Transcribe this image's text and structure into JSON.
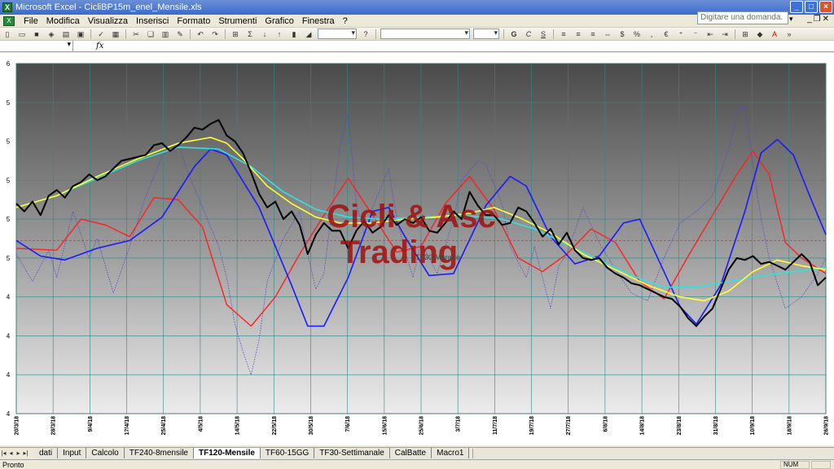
{
  "window": {
    "title": "Microsoft Excel - CicliBP15m_enel_Mensile.xls"
  },
  "menu": [
    "File",
    "Modifica",
    "Visualizza",
    "Inserisci",
    "Formato",
    "Strumenti",
    "Grafico",
    "Finestra",
    "?"
  ],
  "help_placeholder": "Digitare una domanda.",
  "formula": {
    "fx_label": "fx"
  },
  "watermark": {
    "line1": "Cicli & Asc",
    "line2": "Trading"
  },
  "series_label": "TF30-Mensile",
  "sheet_tabs": [
    "dati",
    "Input",
    "Calcolo",
    "TF240-8mensile",
    "TF120-Mensile",
    "TF60-15GG",
    "TF30-Settimanale",
    "CalBatte",
    "Macro1"
  ],
  "active_tab": "TF120-Mensile",
  "status": {
    "text": "Pronto",
    "num": "NUM"
  },
  "colors": {
    "price": "#000000",
    "cycle_red": "#ff2020",
    "cycle_blue": "#1a1aff",
    "ma_yellow": "#ffff33",
    "ma_cyan": "#33e0e0",
    "oscillator": "#4a4ad0",
    "ref_line": "#ff3030",
    "watermark": "#a01010"
  },
  "chart_data": {
    "type": "line",
    "y_ticks": [
      "6",
      "5",
      "5",
      "5",
      "5",
      "5",
      "4",
      "4",
      "4",
      "4"
    ],
    "x_ticks": [
      "20/3/18",
      "28/3/18",
      "9/4/18",
      "17/4/18",
      "25/4/18",
      "4/5/18",
      "14/5/18",
      "22/5/18",
      "30/5/18",
      "7/6/18",
      "15/6/18",
      "25/6/18",
      "3/7/18",
      "11/7/18",
      "19/7/18",
      "27/7/18",
      "6/8/18",
      "14/8/18",
      "23/8/18",
      "31/8/18",
      "10/9/18",
      "18/9/18",
      "26/9/18"
    ],
    "x_domain": [
      0,
      100
    ],
    "y_domain": [
      0,
      9
    ],
    "reference_level": 4.45,
    "series": [
      {
        "key": "price",
        "values": [
          [
            0,
            5.4
          ],
          [
            1,
            5.2
          ],
          [
            2,
            5.45
          ],
          [
            3,
            5.1
          ],
          [
            4,
            5.6
          ],
          [
            5,
            5.75
          ],
          [
            6,
            5.55
          ],
          [
            7,
            5.85
          ],
          [
            8,
            5.95
          ],
          [
            9,
            6.15
          ],
          [
            10,
            6.0
          ],
          [
            11,
            6.1
          ],
          [
            12,
            6.3
          ],
          [
            13,
            6.5
          ],
          [
            14,
            6.55
          ],
          [
            15,
            6.6
          ],
          [
            16,
            6.65
          ],
          [
            17,
            6.9
          ],
          [
            18,
            6.95
          ],
          [
            19,
            6.75
          ],
          [
            20,
            6.9
          ],
          [
            21,
            7.1
          ],
          [
            22,
            7.35
          ],
          [
            23,
            7.3
          ],
          [
            24,
            7.45
          ],
          [
            25,
            7.55
          ],
          [
            26,
            7.15
          ],
          [
            27,
            7.0
          ],
          [
            28,
            6.7
          ],
          [
            29,
            6.2
          ],
          [
            30,
            5.65
          ],
          [
            31,
            5.3
          ],
          [
            32,
            5.45
          ],
          [
            33,
            5.0
          ],
          [
            34,
            5.2
          ],
          [
            35,
            4.85
          ],
          [
            36,
            4.1
          ],
          [
            37,
            4.6
          ],
          [
            38,
            4.9
          ],
          [
            39,
            4.7
          ],
          [
            40,
            4.7
          ],
          [
            41,
            4.25
          ],
          [
            42,
            4.7
          ],
          [
            43,
            4.95
          ],
          [
            44,
            4.65
          ],
          [
            45,
            4.8
          ],
          [
            46,
            5.1
          ],
          [
            47,
            4.85
          ],
          [
            48,
            5.0
          ],
          [
            49,
            4.9
          ],
          [
            50,
            5.05
          ],
          [
            51,
            4.7
          ],
          [
            52,
            4.65
          ],
          [
            53,
            4.9
          ],
          [
            54,
            5.2
          ],
          [
            55,
            5.0
          ],
          [
            56,
            5.7
          ],
          [
            57,
            5.35
          ],
          [
            58,
            5.1
          ],
          [
            59,
            5.1
          ],
          [
            60,
            4.85
          ],
          [
            61,
            4.9
          ],
          [
            62,
            5.3
          ],
          [
            63,
            5.2
          ],
          [
            64,
            4.9
          ],
          [
            65,
            4.55
          ],
          [
            66,
            4.75
          ],
          [
            67,
            4.35
          ],
          [
            68,
            4.65
          ],
          [
            69,
            4.2
          ],
          [
            70,
            4.0
          ],
          [
            71,
            3.95
          ],
          [
            72,
            4.0
          ],
          [
            73,
            3.75
          ],
          [
            74,
            3.6
          ],
          [
            75,
            3.5
          ],
          [
            76,
            3.35
          ],
          [
            77,
            3.3
          ],
          [
            78,
            3.2
          ],
          [
            79,
            3.1
          ],
          [
            80,
            3.0
          ],
          [
            81,
            2.95
          ],
          [
            82,
            2.75
          ],
          [
            83,
            2.45
          ],
          [
            84,
            2.25
          ],
          [
            85,
            2.5
          ],
          [
            86,
            2.7
          ],
          [
            87,
            3.2
          ],
          [
            88,
            3.7
          ],
          [
            89,
            4.0
          ],
          [
            90,
            3.95
          ],
          [
            91,
            4.05
          ],
          [
            92,
            3.85
          ],
          [
            93,
            3.9
          ],
          [
            94,
            3.8
          ],
          [
            95,
            3.7
          ],
          [
            96,
            3.9
          ],
          [
            97,
            4.1
          ],
          [
            98,
            3.9
          ],
          [
            99,
            3.3
          ],
          [
            100,
            3.5
          ]
        ]
      },
      {
        "key": "cycle_red",
        "values": [
          [
            0,
            4.25
          ],
          [
            5,
            4.2
          ],
          [
            8,
            5.0
          ],
          [
            11,
            4.85
          ],
          [
            14,
            4.55
          ],
          [
            17,
            5.55
          ],
          [
            20,
            5.5
          ],
          [
            23,
            4.8
          ],
          [
            26,
            2.8
          ],
          [
            29,
            2.25
          ],
          [
            32,
            3.0
          ],
          [
            35,
            4.1
          ],
          [
            38,
            5.1
          ],
          [
            41,
            6.05
          ],
          [
            44,
            5.1
          ],
          [
            47,
            4.15
          ],
          [
            50,
            4.3
          ],
          [
            53,
            5.4
          ],
          [
            56,
            6.1
          ],
          [
            59,
            5.25
          ],
          [
            62,
            4.0
          ],
          [
            65,
            3.65
          ],
          [
            68,
            4.1
          ],
          [
            71,
            4.75
          ],
          [
            74,
            4.4
          ],
          [
            77,
            3.4
          ],
          [
            80,
            2.95
          ],
          [
            83,
            4.05
          ],
          [
            86,
            5.1
          ],
          [
            89,
            6.15
          ],
          [
            91,
            6.75
          ],
          [
            93,
            6.15
          ],
          [
            95,
            4.4
          ],
          [
            97,
            4.0
          ],
          [
            100,
            3.6
          ]
        ]
      },
      {
        "key": "cycle_blue",
        "values": [
          [
            0,
            4.45
          ],
          [
            3,
            4.05
          ],
          [
            6,
            3.95
          ],
          [
            10,
            4.25
          ],
          [
            14,
            4.45
          ],
          [
            18,
            5.05
          ],
          [
            22,
            6.35
          ],
          [
            24,
            6.8
          ],
          [
            26,
            6.65
          ],
          [
            30,
            5.3
          ],
          [
            34,
            3.3
          ],
          [
            36,
            2.25
          ],
          [
            38,
            2.25
          ],
          [
            41,
            3.5
          ],
          [
            44,
            5.2
          ],
          [
            46,
            5.3
          ],
          [
            48,
            4.55
          ],
          [
            51,
            3.55
          ],
          [
            54,
            3.6
          ],
          [
            58,
            5.35
          ],
          [
            61,
            6.1
          ],
          [
            63,
            5.85
          ],
          [
            66,
            4.55
          ],
          [
            69,
            3.85
          ],
          [
            72,
            4.05
          ],
          [
            75,
            4.9
          ],
          [
            77,
            5.0
          ],
          [
            79,
            4.1
          ],
          [
            82,
            2.75
          ],
          [
            84,
            2.3
          ],
          [
            87,
            3.3
          ],
          [
            90,
            5.2
          ],
          [
            92,
            6.7
          ],
          [
            94,
            7.05
          ],
          [
            96,
            6.65
          ],
          [
            98,
            5.6
          ],
          [
            100,
            4.6
          ]
        ]
      },
      {
        "key": "ma_yellow",
        "values": [
          [
            0,
            5.3
          ],
          [
            5,
            5.6
          ],
          [
            10,
            6.1
          ],
          [
            15,
            6.55
          ],
          [
            20,
            6.95
          ],
          [
            24,
            7.1
          ],
          [
            26,
            6.95
          ],
          [
            28,
            6.55
          ],
          [
            31,
            5.85
          ],
          [
            34,
            5.4
          ],
          [
            37,
            5.05
          ],
          [
            40,
            4.9
          ],
          [
            44,
            4.9
          ],
          [
            48,
            5.0
          ],
          [
            52,
            5.05
          ],
          [
            56,
            5.15
          ],
          [
            59,
            5.3
          ],
          [
            62,
            5.05
          ],
          [
            66,
            4.65
          ],
          [
            70,
            4.1
          ],
          [
            74,
            3.7
          ],
          [
            78,
            3.3
          ],
          [
            82,
            3.0
          ],
          [
            85,
            2.9
          ],
          [
            88,
            3.15
          ],
          [
            91,
            3.65
          ],
          [
            94,
            3.95
          ],
          [
            97,
            3.8
          ],
          [
            100,
            3.7
          ]
        ]
      },
      {
        "key": "ma_cyan",
        "values": [
          [
            0,
            5.3
          ],
          [
            5,
            5.6
          ],
          [
            10,
            6.05
          ],
          [
            15,
            6.5
          ],
          [
            20,
            6.85
          ],
          [
            25,
            6.8
          ],
          [
            29,
            6.35
          ],
          [
            33,
            5.7
          ],
          [
            37,
            5.25
          ],
          [
            41,
            5.05
          ],
          [
            45,
            5.0
          ],
          [
            50,
            5.05
          ],
          [
            55,
            5.1
          ],
          [
            60,
            5.0
          ],
          [
            64,
            4.75
          ],
          [
            68,
            4.35
          ],
          [
            72,
            3.95
          ],
          [
            76,
            3.55
          ],
          [
            80,
            3.25
          ],
          [
            84,
            3.25
          ],
          [
            88,
            3.4
          ],
          [
            92,
            3.55
          ],
          [
            96,
            3.65
          ],
          [
            100,
            3.75
          ]
        ]
      },
      {
        "key": "oscillator",
        "values": [
          [
            0,
            4.1
          ],
          [
            2,
            3.4
          ],
          [
            4,
            4.2
          ],
          [
            5,
            3.5
          ],
          [
            7,
            5.2
          ],
          [
            9,
            4.0
          ],
          [
            10,
            4.5
          ],
          [
            12,
            3.1
          ],
          [
            14,
            4.3
          ],
          [
            16,
            5.6
          ],
          [
            18,
            6.6
          ],
          [
            20,
            7.0
          ],
          [
            21,
            6.3
          ],
          [
            23,
            5.3
          ],
          [
            25,
            4.3
          ],
          [
            26,
            3.5
          ],
          [
            27,
            2.3
          ],
          [
            28,
            1.6
          ],
          [
            29,
            1.0
          ],
          [
            30,
            1.9
          ],
          [
            31,
            3.4
          ],
          [
            33,
            4.5
          ],
          [
            35,
            5.2
          ],
          [
            36,
            4.1
          ],
          [
            37,
            3.2
          ],
          [
            38,
            3.6
          ],
          [
            40,
            6.9
          ],
          [
            41,
            7.7
          ],
          [
            42,
            5.4
          ],
          [
            43,
            4.6
          ],
          [
            44,
            5.3
          ],
          [
            46,
            6.3
          ],
          [
            47,
            5.0
          ],
          [
            48,
            4.2
          ],
          [
            49,
            3.5
          ],
          [
            50,
            4.4
          ],
          [
            52,
            3.6
          ],
          [
            54,
            5.0
          ],
          [
            55,
            6.0
          ],
          [
            57,
            6.5
          ],
          [
            58,
            6.4
          ],
          [
            60,
            5.4
          ],
          [
            61,
            4.3
          ],
          [
            63,
            3.5
          ],
          [
            64,
            4.3
          ],
          [
            65,
            3.5
          ],
          [
            66,
            2.7
          ],
          [
            67,
            3.8
          ],
          [
            68,
            4.1
          ],
          [
            70,
            5.3
          ],
          [
            72,
            4.4
          ],
          [
            74,
            3.7
          ],
          [
            76,
            3.1
          ],
          [
            78,
            2.9
          ],
          [
            80,
            4.0
          ],
          [
            82,
            4.9
          ],
          [
            84,
            5.2
          ],
          [
            86,
            5.6
          ],
          [
            88,
            6.8
          ],
          [
            89,
            7.7
          ],
          [
            90,
            7.9
          ],
          [
            91,
            6.4
          ],
          [
            92,
            5.0
          ],
          [
            93,
            4.0
          ],
          [
            95,
            2.7
          ],
          [
            97,
            3.0
          ],
          [
            99,
            3.6
          ],
          [
            100,
            4.0
          ]
        ]
      }
    ]
  }
}
